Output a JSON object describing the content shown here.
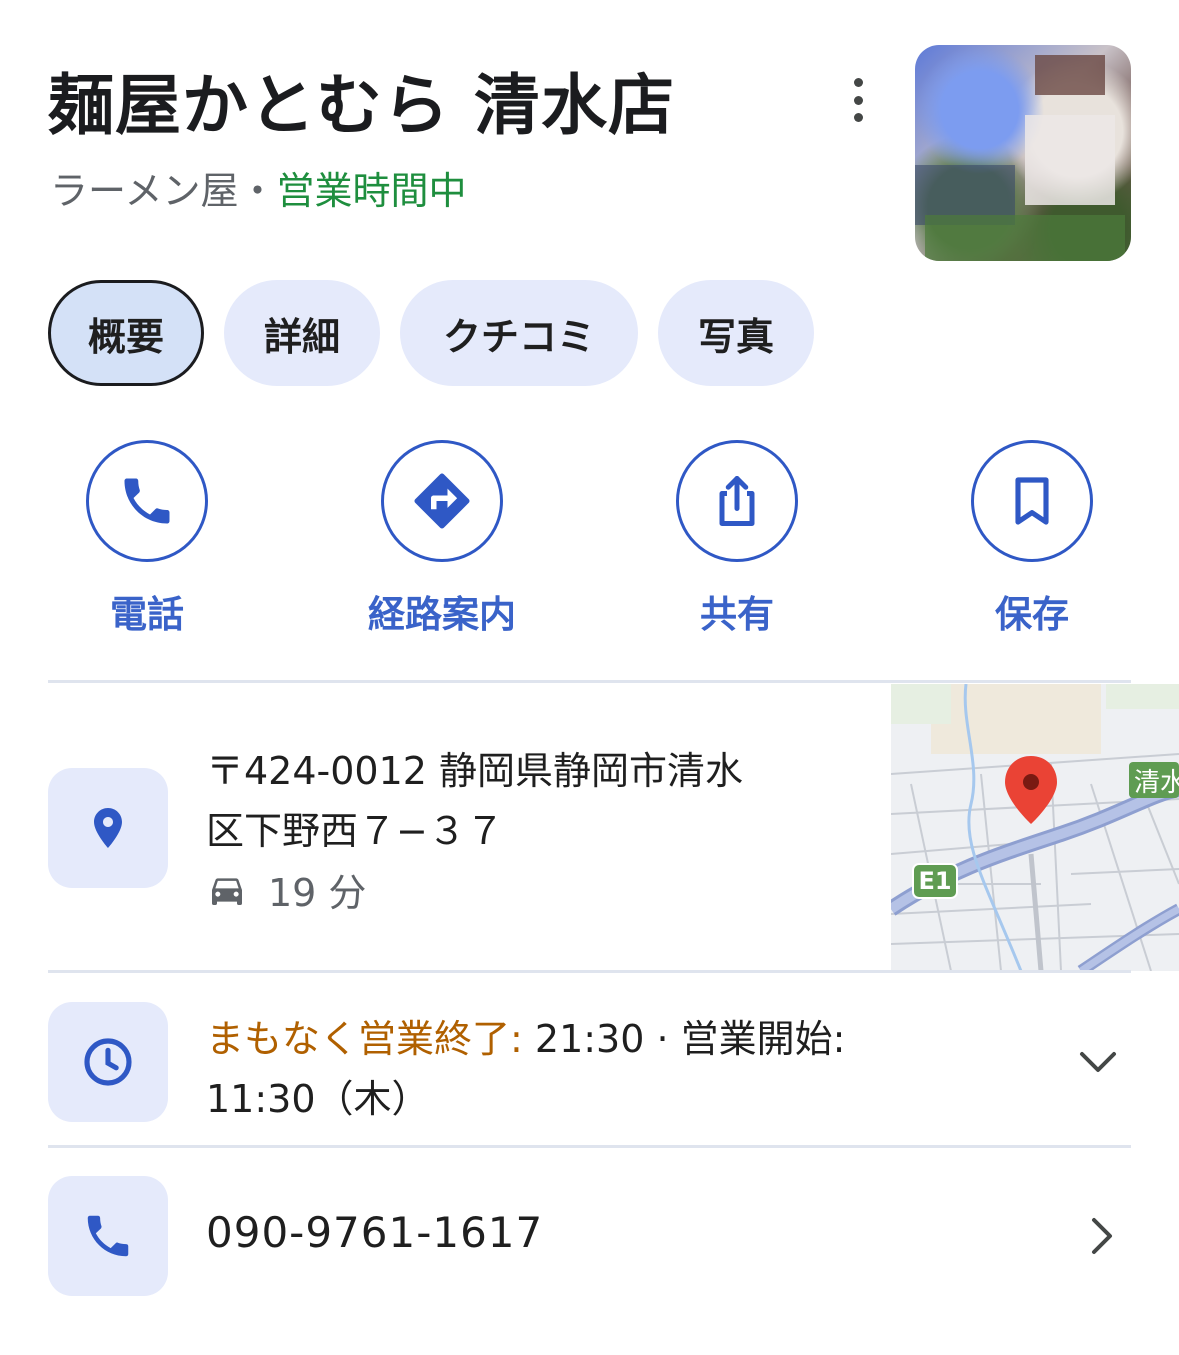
{
  "place": {
    "name": "麺屋かとむら 清水店",
    "category": "ラーメン屋",
    "separator": "・",
    "open_status": "営業時間中"
  },
  "tabs": [
    {
      "label": "概要",
      "active": true
    },
    {
      "label": "詳細",
      "active": false
    },
    {
      "label": "クチコミ",
      "active": false
    },
    {
      "label": "写真",
      "active": false
    }
  ],
  "actions": [
    {
      "label": "電話",
      "icon": "phone-icon"
    },
    {
      "label": "経路案内",
      "icon": "directions-icon"
    },
    {
      "label": "共有",
      "icon": "share-icon"
    },
    {
      "label": "保存",
      "icon": "bookmark-icon"
    }
  ],
  "address": {
    "line1": "〒424-0012 静岡県静岡市清水",
    "line2": "区下野西７−３７",
    "drive_time": "19 分",
    "map_labels": {
      "route": "E1",
      "area": "清水"
    }
  },
  "hours": {
    "status": "まもなく営業終了:",
    "close_time": " 21:30 · 営業開始:",
    "next_open": "11:30（木）"
  },
  "phone": {
    "number": "090-9761-1617"
  },
  "colors": {
    "accent_blue": "#2f58c5",
    "open_green": "#1e8e3e",
    "warning_orange": "#b06000",
    "chip_bg": "#e5eafb",
    "pin_red": "#ea4335"
  }
}
